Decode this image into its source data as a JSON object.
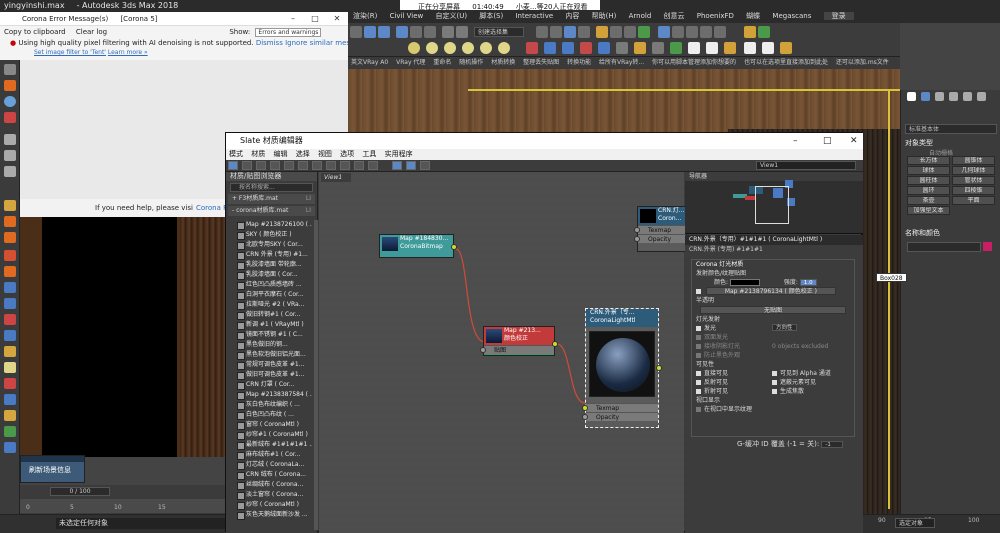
{
  "max": {
    "title_items": [
      "yingyinshi.max",
      "- Autodesk 3ds Max 2018"
    ],
    "menu": [
      "渲染(R)",
      "Civil View",
      "自定义(U)",
      "脚本(S)",
      "Interactive",
      "内容",
      "帮助(H)",
      "Arnold",
      "创意云",
      "PhoenixFD",
      "蝴蝶",
      "Megascans"
    ],
    "login": "登录",
    "create_selection": "创建选择集",
    "toolbar3_items": [
      "英文VRay A0",
      "VRay 代理",
      "重命名",
      "随机操作",
      "材质转换",
      "整理丢失贴图",
      "转换功能",
      "给所有VRay转...",
      "你可以用脚本管理添加你想要的",
      "也可以在选项里直接添加到此处",
      "还可以添加.ms文件"
    ],
    "status_text": "未选定任何对象",
    "selection_combo": "选定对象",
    "right_ruler": [
      "90",
      "95",
      "100"
    ]
  },
  "share": {
    "label": "正在分享屏幕",
    "time": "01:40:49",
    "viewers": "小麦...等20人正在观看"
  },
  "corona_errors": {
    "title": "Corona Error Message(s)",
    "count": "[Corona 5]",
    "copy_label": "Copy to clipboard",
    "clear_label": "Clear log",
    "show_label": "Show:",
    "show_value": "Errors and warnings",
    "message": "Using high quality pixel filtering with AI denoising is not supported.",
    "dismiss": "Dismiss",
    "ignore": "Ignore similar messa",
    "set_filter": "Set image filter to 'Tent'",
    "learn_more": "Learn more »"
  },
  "vfb": {
    "help_text": "If you need help, please visi",
    "link": "Corona Renc"
  },
  "popup": {
    "label": "刷新场景信息"
  },
  "timeline": {
    "frame": "0 / 100",
    "ticks": [
      "0",
      "5",
      "10",
      "15"
    ]
  },
  "slate": {
    "title": "Slate 材质编辑器",
    "menu": [
      "模式",
      "材质",
      "编辑",
      "选择",
      "视图",
      "选项",
      "工具",
      "实用程序"
    ],
    "view_combo": "View1",
    "browser_title": "材质/贴图浏览器",
    "search": "按名称搜索...",
    "sections": [
      {
        "label": "+ F3材质库.mat",
        "tag": "LI"
      },
      {
        "label": "- corona材质库.mat",
        "tag": "LI"
      }
    ],
    "items": [
      "Map #2138726100 ( ... )",
      "SKY ( 颜色校正 )",
      "北欧专用SKY ( Cor...",
      "CRN 外景 (专用) #1...",
      "乳胶漆墙面 带轮廓...",
      "乳胶漆墙面 ( Cor...",
      "红色凹凸质感墙砖 ...",
      "白洞平衣摩石 ( Cor...",
      "拉斯哑光 #2 ( VRa...",
      "做旧转钢#1 ( Cor...",
      "新调 #1 ( VRayMtl )",
      "镜面不锈钢 #1 ( C...",
      "黑色做旧的钢...",
      "黑色软泡做旧铝光面...",
      "常规可调色皮革 #1...",
      "做旧可调色皮革 #1...",
      "CRN 灯罩 ( Cor...",
      "Map #2138387584 ( ...",
      "灰白色布纹编织 ( ...",
      "白色凹凸布纹 ( ...",
      "窗帘 ( CoronaMtl )",
      "纱帘#1 ( CoronaMtl )",
      "最新绒布 #1#1#1#1 ...",
      "麻布绒布#1 ( Cor...",
      "灯芯绒 ( CoronaLa...",
      "CRN 绒布 ( Corona...",
      "丝绸绒布 ( Corona...",
      "淡土窗帘 ( Corona...",
      "纱帘 ( CoronaMtl )",
      "灰色天鹅绒面新沙发 ..."
    ],
    "canvas_tab": "View1",
    "nodes": {
      "bitmap": {
        "name": "Map #184830...",
        "type": "CoronaBitmap"
      },
      "colorcorrect": {
        "name": "Map #213...",
        "type": "颜色校正",
        "slot": "贴图"
      },
      "lightmtl": {
        "name": "CRN.外景（专...",
        "type": "CoronaLightMtl",
        "slots": [
          "Texmap",
          "Opacity"
        ]
      },
      "partial": {
        "name": "CRN.灯...",
        "type": "Coron...",
        "slots": [
          "Texmap",
          "Opacity"
        ]
      }
    },
    "navigator": "导航器",
    "tooltip": "Box028"
  },
  "params": {
    "title": "CRN.外景（专用）#1#1#1 ( CoronaLightMtl )",
    "subtitle": "CRN.外景 (专用) #1#1#1",
    "rollout": "Corona 灯光材质",
    "emission_title": "发射颜色/纹理贴图",
    "color_label": "颜色:",
    "intensity_label": "强度:",
    "intensity_value": "1.0",
    "map_label": "Map #2138796134 ( 颜色校正 )",
    "translucency": "半透明",
    "none": "无贴图",
    "light_emit": "灯光发射",
    "emit_light": "发光",
    "emit_light_value": "方向性",
    "two_sided": "双面发光",
    "shadow_recv": "接收阴影灯光",
    "occluded": "防止黑色外观",
    "objects_excluded": "0 objects excluded",
    "visibility": "可见性",
    "vis_items": [
      "直接可见",
      "反射可见",
      "折射可见",
      "可见到 Alpha 通道",
      "遮蔽元素可见",
      "生成焦散"
    ],
    "viewport": "视口显示",
    "viewport_item": "在视口中显示纹理",
    "gbuffer_label": "G-缓冲 ID 覆盖 (-1 = 关):",
    "gbuffer_value": "-1"
  },
  "rightpanel": {
    "dropdown": "标准基本体",
    "section1": "对象类型",
    "autogrid": "自动栅格",
    "buttons": [
      "长方体",
      "圆锥体",
      "球体",
      "几何球体",
      "圆柱体",
      "管状体",
      "圆环",
      "四棱锥",
      "茶壶",
      "平面",
      "加强型文本"
    ],
    "section2": "名称和颜色"
  },
  "colors": {
    "accent": "#5d88c8",
    "port": "#c9de2a",
    "wire": "#d24a3a",
    "name_swatch": "#c71e64"
  }
}
